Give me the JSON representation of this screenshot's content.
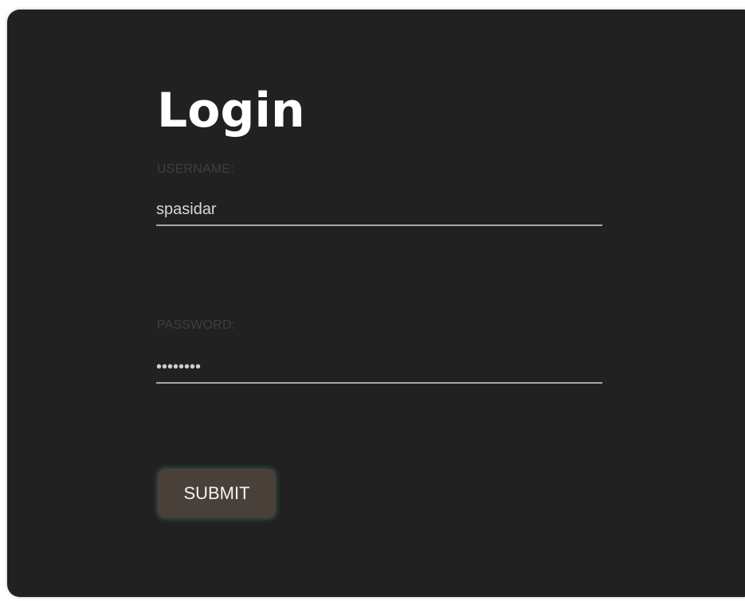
{
  "login": {
    "title": "Login",
    "username_label": "USERNAME:",
    "username_value": "spasidar",
    "password_label": "PASSWORD:",
    "password_value": "••••••••",
    "submit_label": "SUBMIT"
  },
  "colors": {
    "card_background": "#212121",
    "page_background": "#ffffff",
    "title_text": "#ffffff",
    "label_text": "#3e3e3e",
    "input_text": "#d8d8d8",
    "input_underline": "#a9a9a9",
    "button_background": "#4a403a",
    "button_glow": "#3c6e5a"
  }
}
